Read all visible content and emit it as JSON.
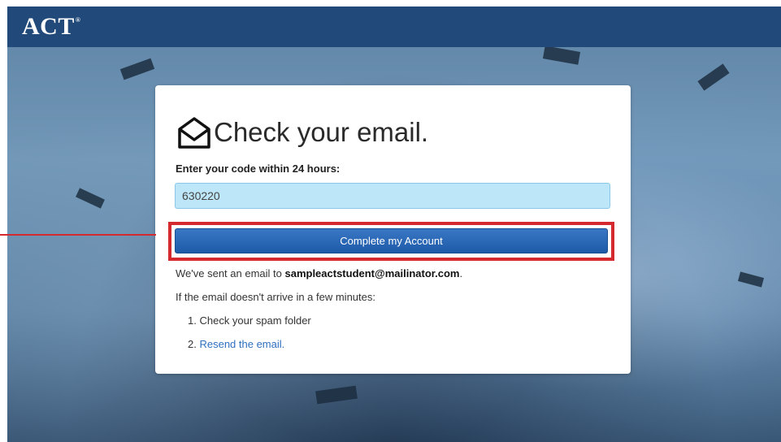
{
  "header": {
    "logo": "ACT",
    "logo_mark": "®"
  },
  "card": {
    "title": "Check your email.",
    "code_label": "Enter your code within 24 hours:",
    "code_value": "630220",
    "submit_label": "Complete my Account",
    "sent_prefix": "We've sent an email to ",
    "sent_email": "sampleactstudent@mailinator.com",
    "sent_suffix": ".",
    "not_arrive": "If the email doesn't arrive in a few minutes:",
    "steps": [
      {
        "num": "1.",
        "text": "Check your spam folder"
      },
      {
        "num": "2.",
        "text": "Resend the email."
      }
    ]
  },
  "colors": {
    "header": "#214a7a",
    "button": "#2563b0",
    "highlight": "#d42a2f",
    "input_bg": "#bde6f8",
    "link": "#2f6fbf"
  },
  "icons": {
    "title_icon": "envelope-open-icon"
  }
}
